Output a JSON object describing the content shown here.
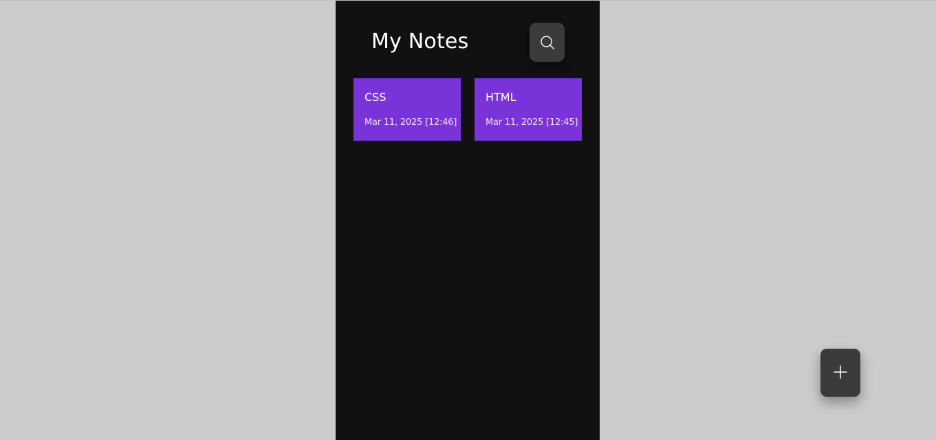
{
  "header": {
    "title": "My Notes",
    "search_icon": "search-icon"
  },
  "notes": [
    {
      "title": "CSS",
      "date": "Mar 11, 2025 [12:46]"
    },
    {
      "title": "HTML",
      "date": "Mar 11, 2025 [12:45]"
    }
  ],
  "fab": {
    "icon": "plus-icon"
  },
  "colors": {
    "page_background": "#cccccc",
    "app_background": "#111111",
    "card": "#7933d9",
    "button": "#3b3b3b",
    "text": "#ffffff"
  }
}
